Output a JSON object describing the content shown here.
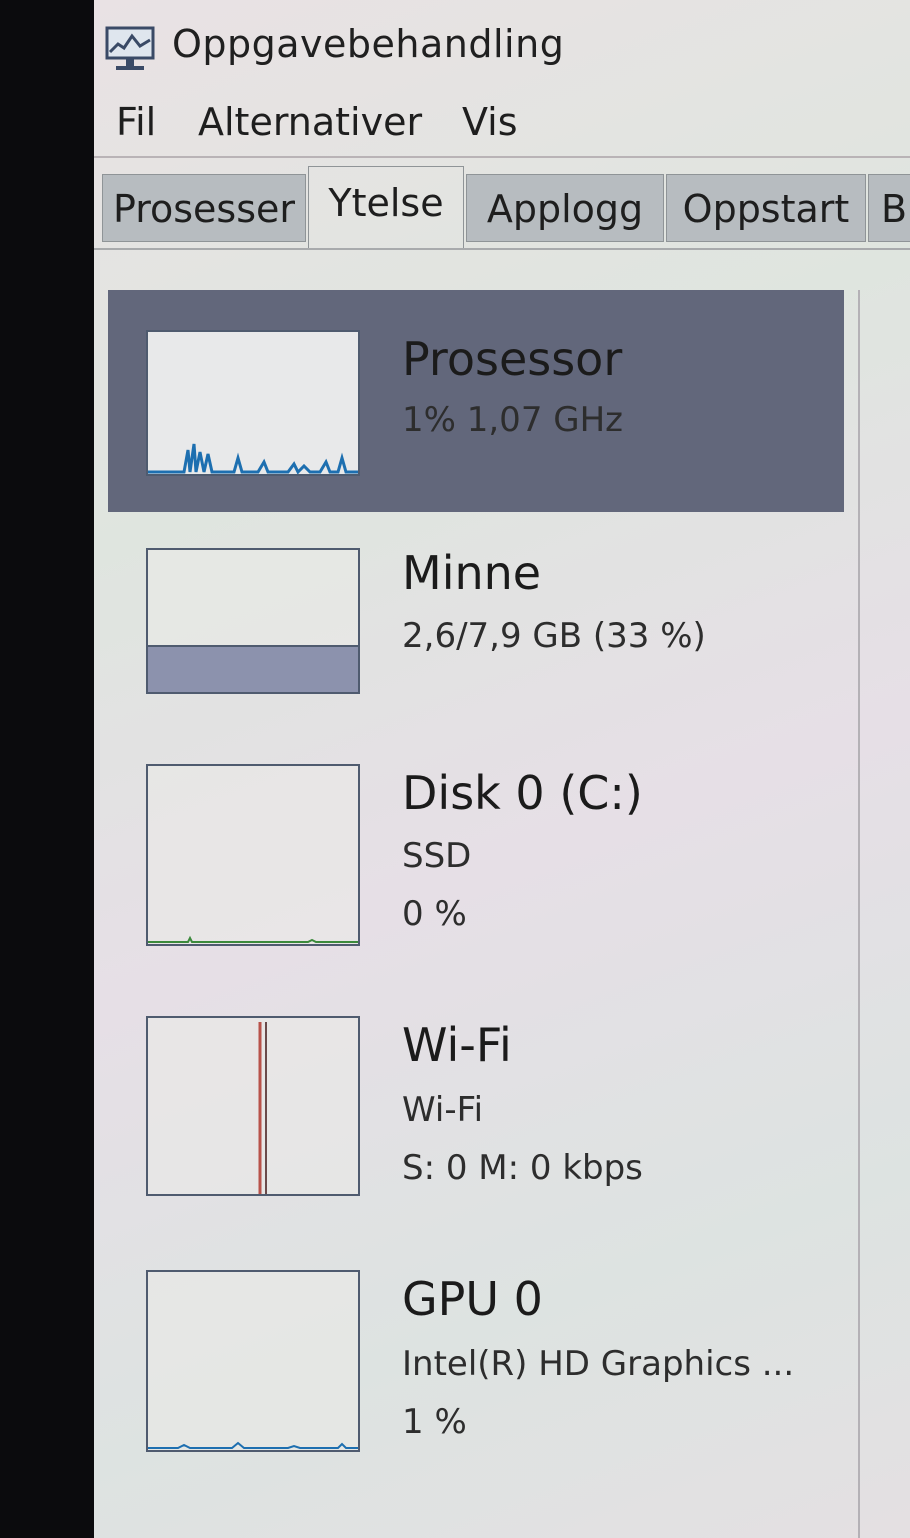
{
  "window": {
    "title": "Oppgavebehandling",
    "icon": "task-manager-icon"
  },
  "menu": {
    "items": [
      "Fil",
      "Alternativer",
      "Vis"
    ]
  },
  "tabs": {
    "items": [
      "Prosesser",
      "Ytelse",
      "Applogg",
      "Oppstart",
      "B"
    ],
    "active": "Ytelse"
  },
  "colors": {
    "selected_bg": "#62677b",
    "cpu_graph": "#1d6fb0",
    "memory_graph": "#8f6bb0",
    "disk_graph": "#3c8a3c",
    "wifi_graph": "#b8524a",
    "gpu_graph": "#1d6fb0"
  },
  "resources": [
    {
      "title": "Prosessor",
      "lines": [
        "1% 1,07 GHz"
      ],
      "selected": true,
      "graph_icon": "cpu-graph"
    },
    {
      "title": "Minne",
      "lines": [
        "2,6/7,9 GB (33 %)"
      ],
      "selected": false,
      "graph_icon": "memory-graph"
    },
    {
      "title": "Disk 0 (C:)",
      "lines": [
        "SSD",
        "0 %"
      ],
      "selected": false,
      "graph_icon": "disk-graph"
    },
    {
      "title": "Wi-Fi",
      "lines": [
        "Wi-Fi",
        "S: 0 M: 0 kbps"
      ],
      "selected": false,
      "graph_icon": "network-graph"
    },
    {
      "title": "GPU 0",
      "lines": [
        "Intel(R) HD Graphics ...",
        "1 %"
      ],
      "selected": false,
      "graph_icon": "gpu-graph"
    }
  ]
}
